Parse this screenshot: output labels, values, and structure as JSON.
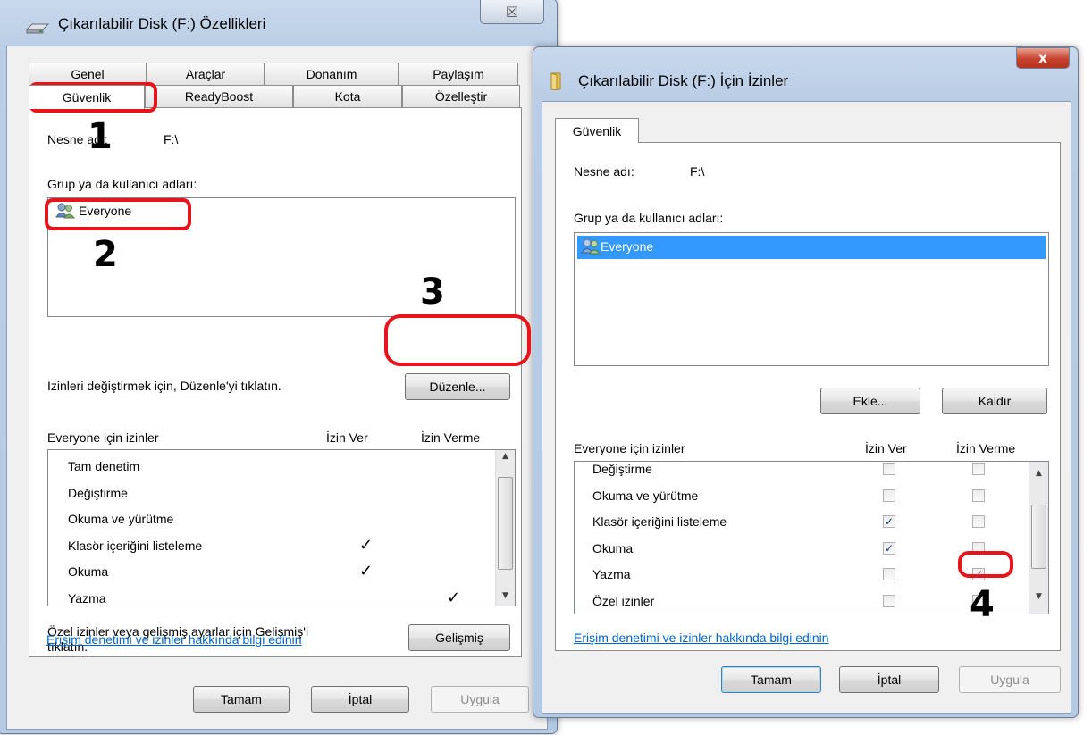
{
  "props_window": {
    "title": "Çıkarılabilir Disk (F:) Özellikleri",
    "close_glyph": "☒",
    "tabs_row1": [
      "Genel",
      "Araçlar",
      "Donanım",
      "Paylaşım"
    ],
    "tabs_row2": [
      "Güvenlik",
      "ReadyBoost",
      "Kota",
      "Özelleştir"
    ],
    "object_label": "Nesne adı:",
    "object_value": "F:\\",
    "group_label": "Grup ya da kullanıcı adları:",
    "users": [
      "Everyone"
    ],
    "edit_hint": "İzinleri değiştirmek için, Düzenle'yi tıklatın.",
    "edit_button": "Düzenle...",
    "perm_header": "Everyone için izinler",
    "allow_header": "İzin Ver",
    "deny_header": "İzin Verme",
    "permissions": [
      {
        "name": "Tam denetim",
        "allow": "",
        "deny": ""
      },
      {
        "name": "Değiştirme",
        "allow": "",
        "deny": ""
      },
      {
        "name": "Okuma ve yürütme",
        "allow": "",
        "deny": ""
      },
      {
        "name": "Klasör içeriğini listeleme",
        "allow": "✓",
        "deny": ""
      },
      {
        "name": "Okuma",
        "allow": "✓",
        "deny": ""
      },
      {
        "name": "Yazma",
        "allow": "",
        "deny": "✓"
      }
    ],
    "advanced_hint_line1": "Özel izinler veya gelişmiş ayarlar için Gelişmiş'i",
    "advanced_hint_line2": "tıklatın.",
    "advanced_button": "Gelişmiş",
    "info_link": "Erişim denetimi ve izinler hakkında bilgi edinin",
    "ok_button": "Tamam",
    "cancel_button": "İptal",
    "apply_button": "Uygula"
  },
  "perm_window": {
    "title": "Çıkarılabilir Disk (F:) İçin İzinler",
    "close_glyph": "x",
    "tab": "Güvenlik",
    "object_label": "Nesne adı:",
    "object_value": "F:\\",
    "group_label": "Grup ya da kullanıcı adları:",
    "users": [
      "Everyone"
    ],
    "add_button": "Ekle...",
    "remove_button": "Kaldır",
    "perm_header": "Everyone için izinler",
    "allow_header": "İzin Ver",
    "deny_header": "İzin Verme",
    "permissions": [
      {
        "name": "Değiştirme",
        "allow": false,
        "deny": false
      },
      {
        "name": "Okuma ve yürütme",
        "allow": false,
        "deny": false
      },
      {
        "name": "Klasör içeriğini listeleme",
        "allow": true,
        "deny": false
      },
      {
        "name": "Okuma",
        "allow": true,
        "deny": false
      },
      {
        "name": "Yazma",
        "allow": false,
        "deny": true
      },
      {
        "name": "Özel izinler",
        "allow": false,
        "deny": false
      }
    ],
    "check_glyph": "✓",
    "info_link": "Erişim denetimi ve izinler hakkında bilgi edinin",
    "ok_button": "Tamam",
    "cancel_button": "İptal",
    "apply_button": "Uygula"
  },
  "annotations": [
    "1",
    "2",
    "3",
    "4"
  ],
  "colors": {
    "annotation_red": "#e8141c",
    "selection_blue": "#3399ff",
    "link_blue": "#0066cc",
    "close_red": "#c7412f"
  }
}
